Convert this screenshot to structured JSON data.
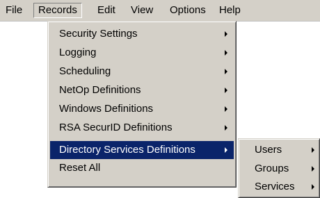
{
  "menubar": {
    "items": [
      {
        "label": "File",
        "hotkey": "F"
      },
      {
        "label": "Records",
        "hotkey": "R"
      },
      {
        "label": "Edit",
        "hotkey": "E"
      },
      {
        "label": "View",
        "hotkey": "V"
      },
      {
        "label": "Options",
        "hotkey": "O"
      },
      {
        "label": "Help",
        "hotkey": "H"
      }
    ],
    "active": "Records"
  },
  "records_menu": {
    "items": [
      {
        "label": "Security Settings",
        "submenu": true
      },
      {
        "label": "Logging",
        "submenu": true
      },
      {
        "label": "Scheduling",
        "submenu": true
      },
      {
        "label": "NetOp Definitions",
        "submenu": true
      },
      {
        "label": "Windows Definitions",
        "submenu": true
      },
      {
        "label": "RSA SecurID Definitions",
        "submenu": true
      },
      {
        "label": "Directory Services Definitions",
        "submenu": true,
        "highlighted": true
      },
      {
        "label": "Reset All",
        "submenu": false
      }
    ]
  },
  "directory_services_submenu": {
    "items": [
      {
        "label": "Users",
        "submenu": true
      },
      {
        "label": "Groups",
        "submenu": true
      },
      {
        "label": "Services",
        "submenu": true
      }
    ]
  },
  "colors": {
    "menu_bg": "#d4d0c8",
    "highlight_bg": "#0a246a",
    "highlight_text": "#ffffff"
  }
}
